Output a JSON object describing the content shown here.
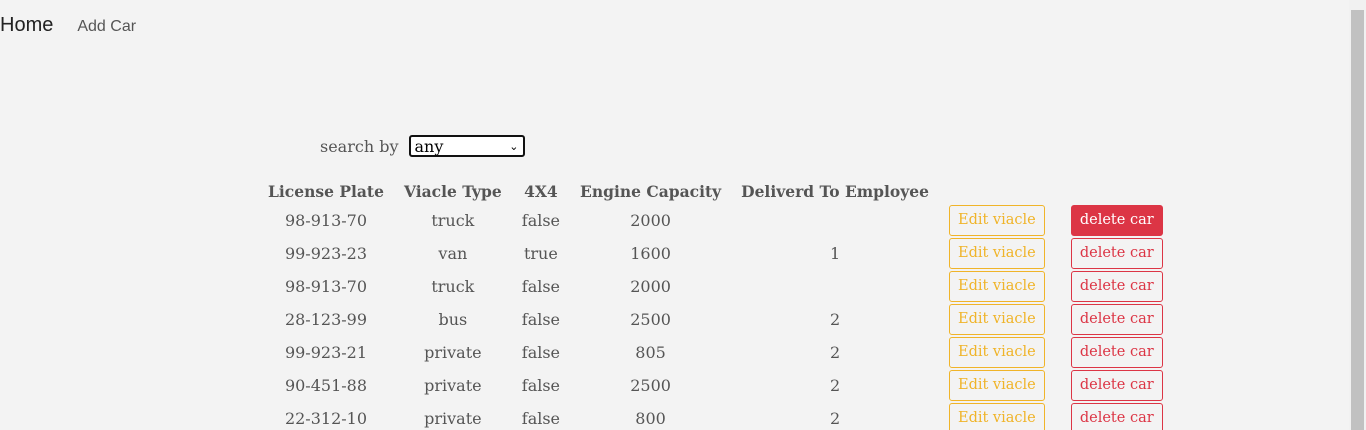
{
  "nav": {
    "brand": "Home",
    "add_car": "Add Car"
  },
  "search": {
    "label": "search by",
    "selected": "any"
  },
  "table": {
    "headers": [
      "License Plate",
      "Viacle Type",
      "4X4",
      "Engine Capacity",
      "Deliverd To Employee"
    ],
    "edit_label": "Edit viacle",
    "delete_label": "delete car",
    "rows": [
      {
        "plate": "98-913-70",
        "type": "truck",
        "fourbyfour": "false",
        "engine": "2000",
        "employee": ""
      },
      {
        "plate": "99-923-23",
        "type": "van",
        "fourbyfour": "true",
        "engine": "1600",
        "employee": "1"
      },
      {
        "plate": "98-913-70",
        "type": "truck",
        "fourbyfour": "false",
        "engine": "2000",
        "employee": ""
      },
      {
        "plate": "28-123-99",
        "type": "bus",
        "fourbyfour": "false",
        "engine": "2500",
        "employee": "2"
      },
      {
        "plate": "99-923-21",
        "type": "private",
        "fourbyfour": "false",
        "engine": "805",
        "employee": "2"
      },
      {
        "plate": "90-451-88",
        "type": "private",
        "fourbyfour": "false",
        "engine": "2500",
        "employee": "2"
      },
      {
        "plate": "22-312-10",
        "type": "private",
        "fourbyfour": "false",
        "engine": "800",
        "employee": "2"
      }
    ]
  },
  "colors": {
    "edit": "#f0b429",
    "delete": "#dc3545",
    "background": "#f3f3f3"
  }
}
